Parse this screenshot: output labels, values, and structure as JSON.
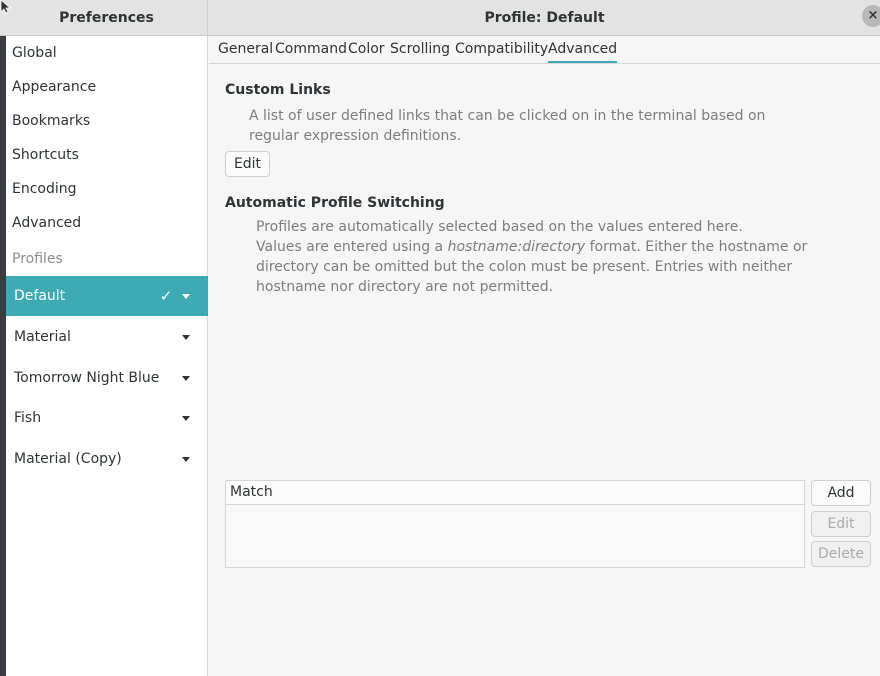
{
  "header": {
    "left_title": "Preferences",
    "title": "Profile: Default",
    "close_glyph": "×"
  },
  "sidebar": {
    "items": [
      {
        "label": "Global"
      },
      {
        "label": "Appearance"
      },
      {
        "label": "Bookmarks"
      },
      {
        "label": "Shortcuts"
      },
      {
        "label": "Encoding"
      },
      {
        "label": "Advanced"
      }
    ],
    "section_label": "Profiles",
    "profiles": [
      {
        "label": "Default",
        "selected": true,
        "check": "✓"
      },
      {
        "label": "Material",
        "selected": false
      },
      {
        "label": "Tomorrow Night Blue",
        "selected": false
      },
      {
        "label": "Fish",
        "selected": false
      },
      {
        "label": "Material (Copy)",
        "selected": false
      }
    ]
  },
  "tabs": [
    {
      "label": "General"
    },
    {
      "label": "Command"
    },
    {
      "label": "Color"
    },
    {
      "label": "Scrolling"
    },
    {
      "label": "Compatibility"
    },
    {
      "label": "Advanced",
      "active": true
    }
  ],
  "custom_links": {
    "title": "Custom Links",
    "desc_line1": "A list of user defined links that can be clicked on in the terminal based on",
    "desc_line2": "regular expression definitions.",
    "edit_label": "Edit"
  },
  "auto_switch": {
    "title": "Automatic Profile Switching",
    "desc_line1": "Profiles are automatically selected based on the values entered here.",
    "desc_line2_pre": "Values are entered using a ",
    "desc_line2_em": "hostname:directory",
    "desc_line2_post": " format. Either the hostname or",
    "desc_line3": "directory can be omitted but the colon must be present. Entries with neither",
    "desc_line4": "hostname nor directory are not permitted.",
    "column_header": "Match",
    "add_label": "Add",
    "edit_label": "Edit",
    "delete_label": "Delete"
  },
  "colors": {
    "accent": "#3daab4",
    "sidebar_bg": "#ffffff",
    "window_bg": "#f6f6f6",
    "header_bg": "#e3e3e3",
    "muted_text": "#7b7e7f"
  },
  "icons": {
    "close": "close-icon",
    "check": "checkmark-icon",
    "dropdown": "chevron-down-icon",
    "cursor": "mouse-pointer-icon"
  }
}
